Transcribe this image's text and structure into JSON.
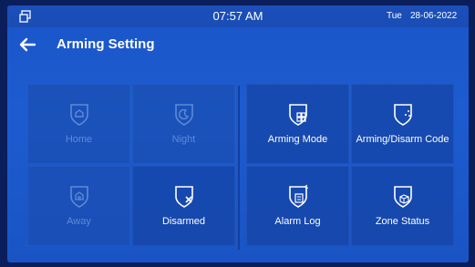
{
  "status": {
    "time": "07:57 AM",
    "day": "Tue",
    "date": "28-06-2022",
    "window_icon": "window-restore-icon"
  },
  "header": {
    "back_icon": "arrow-left-icon",
    "title": "Arming Setting"
  },
  "modes": [
    {
      "label": "Home",
      "icon": "shield-home-icon",
      "enabled": false
    },
    {
      "label": "Night",
      "icon": "shield-moon-icon",
      "enabled": false
    },
    {
      "label": "Away",
      "icon": "shield-house-icon",
      "enabled": false
    },
    {
      "label": "Disarmed",
      "icon": "shield-x-icon",
      "enabled": true
    }
  ],
  "settings": [
    {
      "label": "Arming Mode",
      "icon": "shield-grid-icon"
    },
    {
      "label": "Arming/Disarm Code",
      "icon": "shield-key-icon"
    },
    {
      "label": "Alarm Log",
      "icon": "shield-log-icon"
    },
    {
      "label": "Zone Status",
      "icon": "shield-check-icon"
    }
  ],
  "colors": {
    "background": "#1c5cd0",
    "tile": "#1a4bac",
    "disabled_text": "#5f8ad6",
    "text": "#ffffff"
  }
}
